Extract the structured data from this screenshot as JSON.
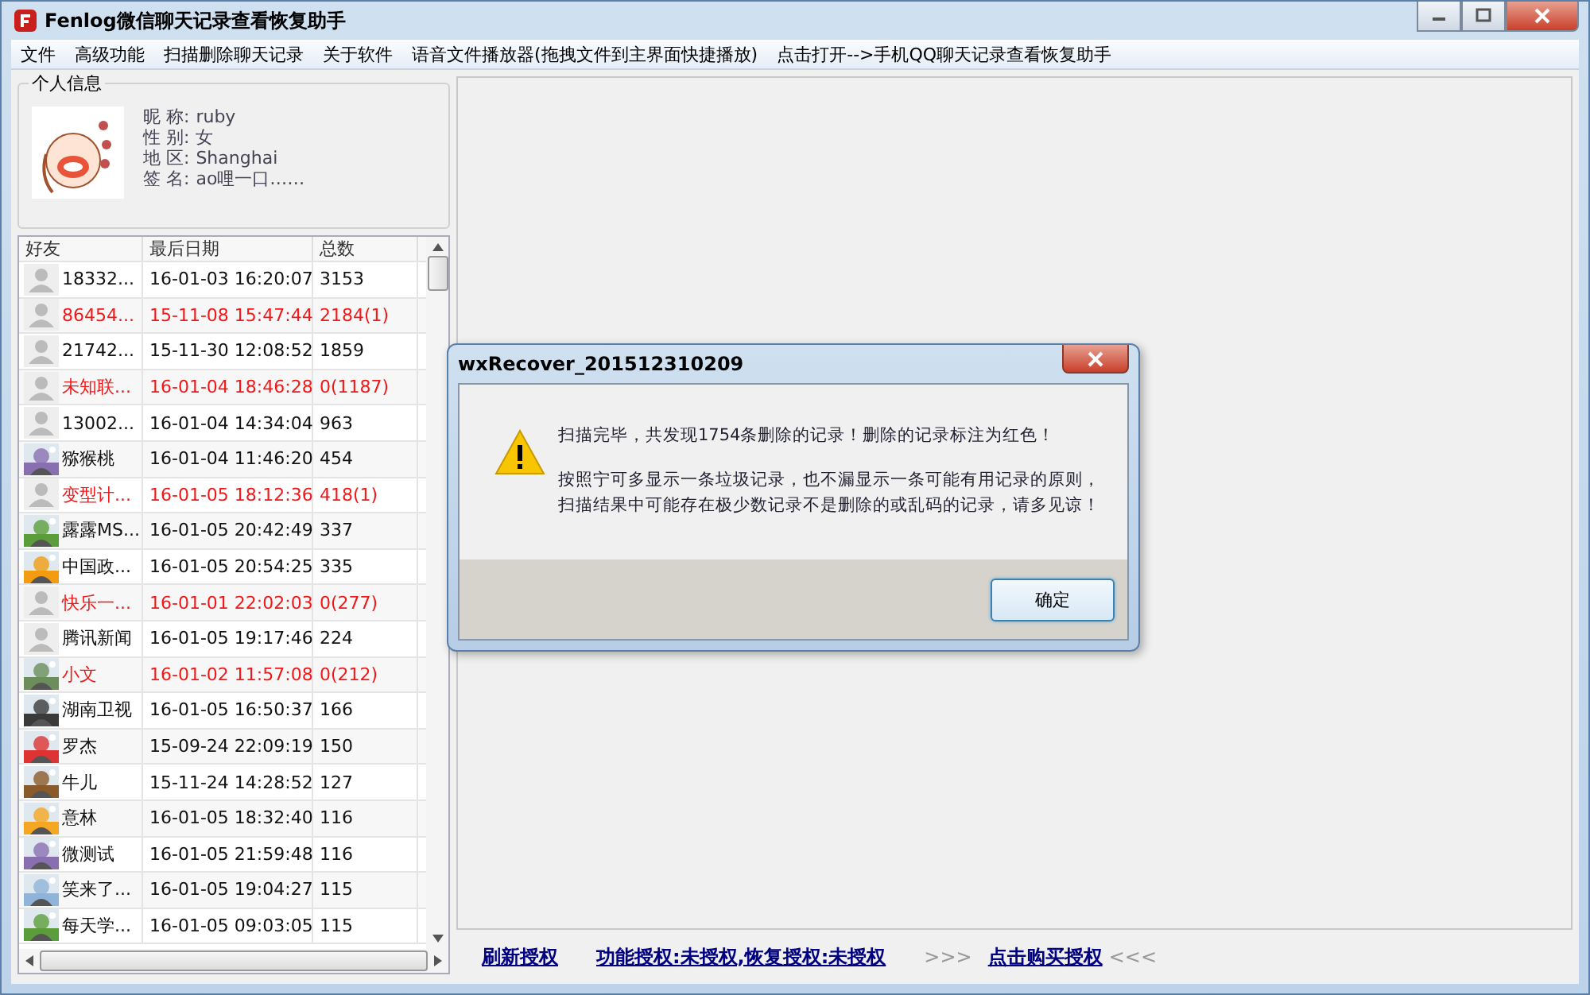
{
  "window": {
    "title": "Fenlog微信聊天记录查看恢复助手"
  },
  "menu": [
    {
      "label": "文件"
    },
    {
      "label": "高级功能"
    },
    {
      "label": "扫描删除聊天记录"
    },
    {
      "label": "关于软件"
    },
    {
      "label": "语音文件播放器(拖拽文件到主界面快捷播放)"
    },
    {
      "label": "点击打开-->手机QQ聊天记录查看恢复助手"
    }
  ],
  "profile": {
    "title": "个人信息",
    "fields": [
      {
        "label": "昵 称:",
        "value": "ruby"
      },
      {
        "label": "性 别:",
        "value": "女"
      },
      {
        "label": "地 区:",
        "value": "Shanghai"
      },
      {
        "label": "签 名:",
        "value": "ao哩一口……"
      }
    ]
  },
  "table": {
    "columns": [
      "好友",
      "最后日期",
      "总数"
    ],
    "rows": [
      {
        "name": "18332...",
        "date": "16-01-03 16:20:07",
        "total": "3153",
        "deleted": false,
        "kind": "placeholder"
      },
      {
        "name": "86454...",
        "date": "15-11-08 15:47:44",
        "total": "2184(1)",
        "deleted": true,
        "kind": "placeholder"
      },
      {
        "name": "21742...",
        "date": "15-11-30 12:08:52",
        "total": "1859",
        "deleted": false,
        "kind": "placeholder"
      },
      {
        "name": "未知联...",
        "date": "16-01-04 18:46:28",
        "total": "0(1187)",
        "deleted": true,
        "kind": "placeholder"
      },
      {
        "name": "13002...",
        "date": "16-01-04 14:34:04",
        "total": "963",
        "deleted": false,
        "kind": "placeholder"
      },
      {
        "name": "猕猴桃",
        "date": "16-01-04 11:46:20",
        "total": "454",
        "deleted": false
      },
      {
        "name": "变型计...",
        "date": "16-01-05 18:12:36",
        "total": "418(1)",
        "deleted": true,
        "kind": "placeholder"
      },
      {
        "name": "露露MS...",
        "date": "16-01-05 20:42:49",
        "total": "337",
        "deleted": false
      },
      {
        "name": "中国政...",
        "date": "16-01-05 20:54:25",
        "total": "335",
        "deleted": false
      },
      {
        "name": "快乐一...",
        "date": "16-01-01 22:02:03",
        "total": "0(277)",
        "deleted": true,
        "kind": "placeholder"
      },
      {
        "name": "腾讯新闻",
        "date": "16-01-05 19:17:46",
        "total": "224",
        "deleted": false,
        "kind": "placeholder"
      },
      {
        "name": "小文",
        "date": "16-01-02 11:57:08",
        "total": "0(212)",
        "deleted": true
      },
      {
        "name": "湖南卫视",
        "date": "16-01-05 16:50:37",
        "total": "166",
        "deleted": false
      },
      {
        "name": "罗杰",
        "date": "15-09-24 22:09:19",
        "total": "150",
        "deleted": false
      },
      {
        "name": "牛儿",
        "date": "15-11-24 14:28:52",
        "total": "127",
        "deleted": false
      },
      {
        "name": "意林",
        "date": "16-01-05 18:32:40",
        "total": "116",
        "deleted": false
      },
      {
        "name": "微测试",
        "date": "16-01-05 21:59:48",
        "total": "116",
        "deleted": false
      },
      {
        "name": "笑来了...",
        "date": "16-01-05 19:04:27",
        "total": "115",
        "deleted": false
      },
      {
        "name": "每天学...",
        "date": "16-01-05 09:03:05",
        "total": "115",
        "deleted": false
      }
    ]
  },
  "footer_links": [
    {
      "label": "刷新授权"
    },
    {
      "label": "功能授权:未授权,恢复授权:未授权"
    },
    {
      "label": "点击购买授权",
      "prefix": ">>>",
      "suffix": "<<<"
    }
  ],
  "dialog": {
    "title": "wxRecover_201512310209",
    "messages": [
      "扫描完毕，共发现1754条删除的记录！删除的记录标注为红色！",
      "按照宁可多显示一条垃圾记录，也不漏显示一条可能有用记录的原则，扫描结果中可能存在极少数记录不是删除的或乱码的记录，请多见谅！"
    ],
    "button": "确定"
  }
}
